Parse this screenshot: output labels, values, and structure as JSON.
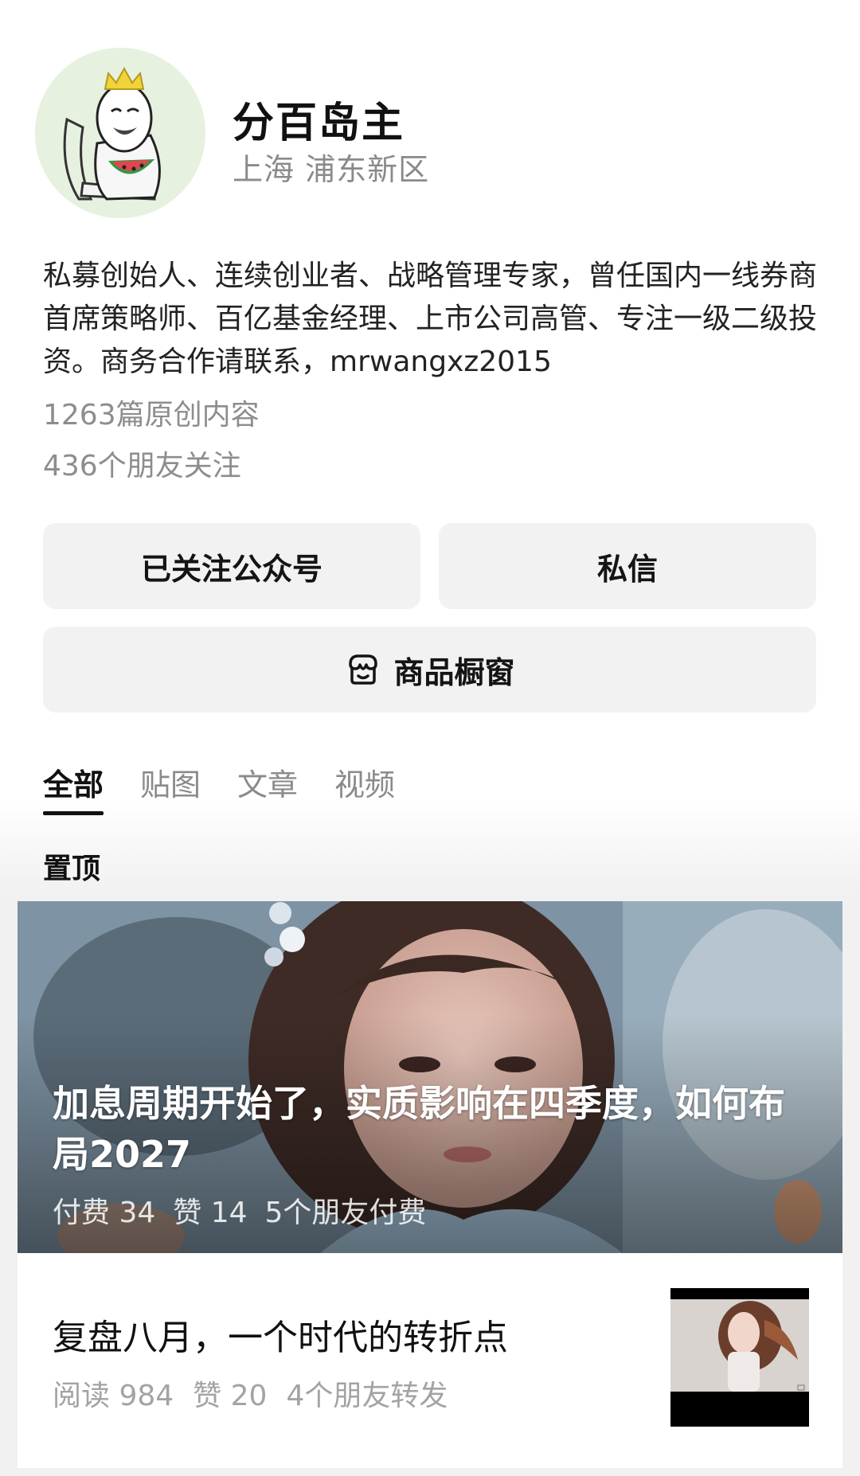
{
  "profile": {
    "name": "分百岛主",
    "location": "上海 浦东新区",
    "bio": "私募创始人、连续创业者、战略管理专家，曾任国内一线券商首席策略师、百亿基金经理、上市公司高管、专注一级二级投资。商务合作请联系，mrwangxz2015",
    "articles_count": "1263篇原创内容",
    "friends_following": "436个朋友关注",
    "avatar_icon": "meme-face-crown-watermelon-avatar"
  },
  "actions": {
    "followed_label": "已关注公众号",
    "message_label": "私信",
    "shop_label": "商品橱窗",
    "shop_icon": "shop-awning-icon"
  },
  "tabs": [
    {
      "label": "全部",
      "active": true
    },
    {
      "label": "贴图",
      "active": false
    },
    {
      "label": "文章",
      "active": false
    },
    {
      "label": "视频",
      "active": false
    }
  ],
  "pinned": {
    "section_label": "置顶",
    "title": "加息周期开始了，实质影响在四季度，如何布局2027",
    "paid": "付费 34",
    "likes": "赞 14",
    "friends_paid": "5个朋友付费"
  },
  "article": {
    "title": "复盘八月，一个时代的转折点",
    "reads": "阅读 984",
    "likes": "赞 20",
    "friends_shared": "4个朋友转发"
  }
}
